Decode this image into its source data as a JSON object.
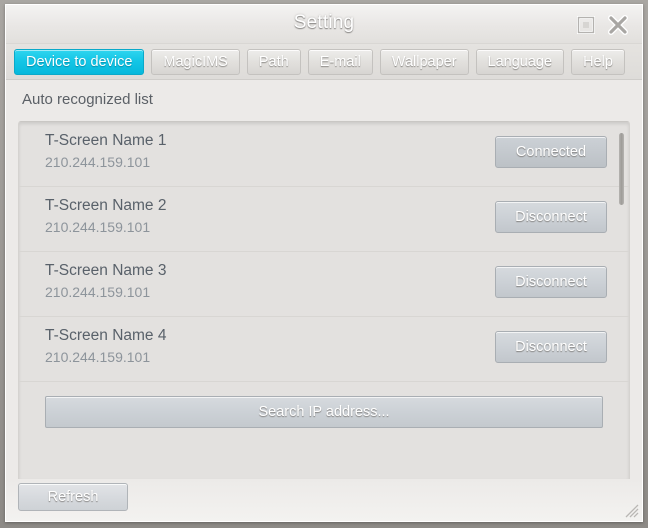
{
  "window": {
    "title": "Setting",
    "controls": {
      "maximize_icon": "maximize-icon",
      "close_icon": "close-icon"
    }
  },
  "tabs": [
    {
      "label": "Device to device",
      "active": true
    },
    {
      "label": "MagicIMS",
      "active": false
    },
    {
      "label": "Path",
      "active": false
    },
    {
      "label": "E-mail",
      "active": false
    },
    {
      "label": "Wallpaper",
      "active": false
    },
    {
      "label": "Language",
      "active": false
    },
    {
      "label": "Help",
      "active": false
    }
  ],
  "main": {
    "section_title": "Auto recognized list",
    "devices": [
      {
        "name": "T-Screen Name 1",
        "ip": "210.244.159.101",
        "action": "Connected",
        "state": "connected"
      },
      {
        "name": "T-Screen Name 2",
        "ip": "210.244.159.101",
        "action": "Disconnect",
        "state": "disconnect"
      },
      {
        "name": "T-Screen Name 3",
        "ip": "210.244.159.101",
        "action": "Disconnect",
        "state": "disconnect"
      },
      {
        "name": "T-Screen Name 4",
        "ip": "210.244.159.101",
        "action": "Disconnect",
        "state": "disconnect"
      }
    ],
    "search_button": "Search IP address..."
  },
  "footer": {
    "refresh_label": "Refresh"
  },
  "colors": {
    "accent": "#14c6e6",
    "window_frame": "#8d8a86",
    "panel_bg": "#e3e1df",
    "text_primary": "#59616a",
    "text_secondary": "#8d949b"
  }
}
